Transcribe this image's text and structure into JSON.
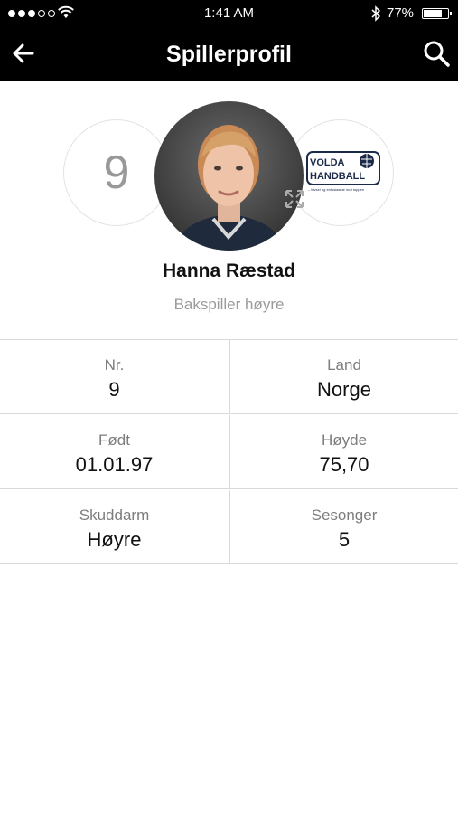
{
  "status_bar": {
    "time": "1:41 AM",
    "battery_percent": "77%",
    "battery_level": 0.77,
    "signal_dots_filled": 3,
    "signal_dots_total": 5
  },
  "nav": {
    "title": "Spillerprofil",
    "back_icon": "back-arrow-icon",
    "search_icon": "search-icon"
  },
  "player": {
    "number": "9",
    "name": "Hanna Ræstad",
    "position": "Bakspiller høyre"
  },
  "club_logo": {
    "line1": "VOLDA",
    "line2": "HANDBALL",
    "tagline": "– trivsel og entusiasme mot toppen"
  },
  "stats": [
    {
      "label": "Nr.",
      "value": "9"
    },
    {
      "label": "Land",
      "value": "Norge"
    },
    {
      "label": "Født",
      "value": "01.01.97"
    },
    {
      "label": "Høyde",
      "value": "75,70"
    },
    {
      "label": "Skuddarm",
      "value": "Høyre"
    },
    {
      "label": "Sesonger",
      "value": "5"
    }
  ],
  "colors": {
    "header_bg": "#000000",
    "text_primary": "#111111",
    "text_secondary": "#9b9b9b",
    "divider": "#d9d9d9"
  }
}
